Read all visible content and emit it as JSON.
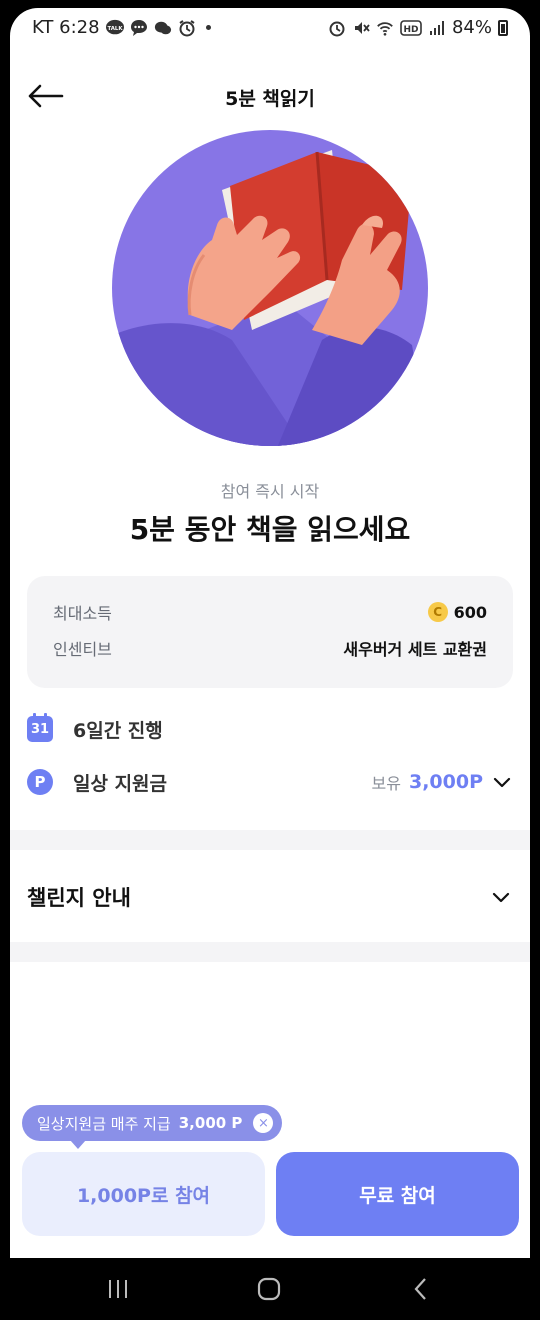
{
  "statusbar": {
    "carrier_time": "KT 6:28",
    "battery": "84%",
    "hd_label": "HD",
    "talk_label": "TALK"
  },
  "header": {
    "title": "5분 책읽기",
    "back_icon": "arrow-left-icon"
  },
  "hero": {
    "description_icon": "hands-holding-book-illustration"
  },
  "challenge": {
    "subtitle": "참여 즉시 시작",
    "title": "5분 동안 책을 읽으세요"
  },
  "info": {
    "max_earning_label": "최대소득",
    "max_earning_value": "600",
    "coin_symbol": "C",
    "incentive_label": "인센티브",
    "incentive_value": "새우버거 세트 교환권"
  },
  "details": {
    "calendar_day": "31",
    "duration_text": "6일간 진행",
    "point_symbol": "P",
    "support_label": "일상 지원금",
    "holding_label": "보유",
    "holding_value": "3,000P"
  },
  "guide": {
    "title": "챌린지 안내"
  },
  "tooltip": {
    "text": "일상지원금 매주 지급",
    "amount": "3,000 P",
    "close_symbol": "×"
  },
  "actions": {
    "points_join": "1,000P로 참여",
    "free_join": "무료 참여"
  },
  "colors": {
    "accent": "#6e7ff3",
    "hero_bg": "#8775e6",
    "card_bg": "#f4f4f6",
    "tooltip_bg": "#8a90e8"
  }
}
